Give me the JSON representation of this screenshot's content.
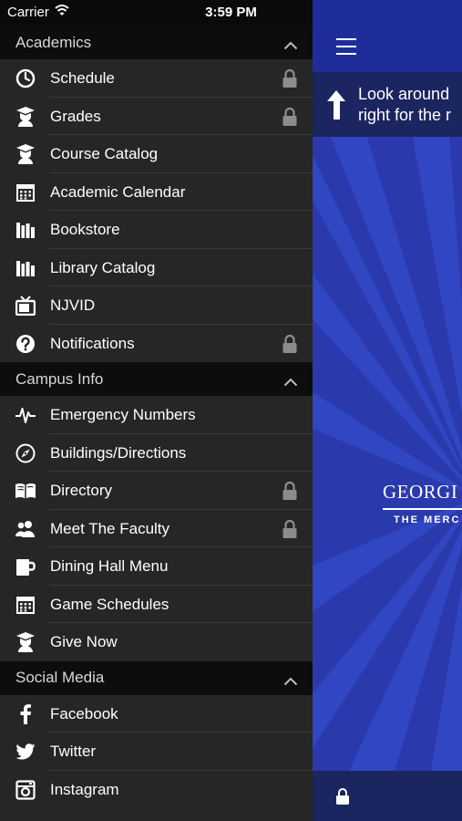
{
  "status_bar": {
    "carrier": "Carrier",
    "time": "3:59 PM"
  },
  "menu": {
    "sections": [
      {
        "title": "Academics",
        "items": [
          {
            "label": "Schedule",
            "icon": "clock-icon",
            "locked": true
          },
          {
            "label": "Grades",
            "icon": "graduate-icon",
            "locked": true
          },
          {
            "label": "Course Catalog",
            "icon": "graduate-icon",
            "locked": false
          },
          {
            "label": "Academic Calendar",
            "icon": "calendar-icon",
            "locked": false
          },
          {
            "label": "Bookstore",
            "icon": "books-icon",
            "locked": false
          },
          {
            "label": "Library Catalog",
            "icon": "books-icon",
            "locked": false
          },
          {
            "label": "NJVID",
            "icon": "tv-icon",
            "locked": false
          },
          {
            "label": "Notifications",
            "icon": "question-icon",
            "locked": true
          }
        ]
      },
      {
        "title": "Campus Info",
        "items": [
          {
            "label": "Emergency Numbers",
            "icon": "pulse-icon",
            "locked": false
          },
          {
            "label": "Buildings/Directions",
            "icon": "compass-icon",
            "locked": false
          },
          {
            "label": "Directory",
            "icon": "book-icon",
            "locked": true
          },
          {
            "label": "Meet The Faculty",
            "icon": "people-icon",
            "locked": true
          },
          {
            "label": "Dining Hall Menu",
            "icon": "mug-icon",
            "locked": false
          },
          {
            "label": "Game Schedules",
            "icon": "calendar-icon",
            "locked": false
          },
          {
            "label": "Give Now",
            "icon": "graduate-icon",
            "locked": false
          }
        ]
      },
      {
        "title": "Social Media",
        "items": [
          {
            "label": "Facebook",
            "icon": "facebook-icon",
            "locked": false
          },
          {
            "label": "Twitter",
            "icon": "twitter-icon",
            "locked": false
          },
          {
            "label": "Instagram",
            "icon": "instagram-icon",
            "locked": false
          }
        ]
      }
    ]
  },
  "app": {
    "banner_line1": "Look around",
    "banner_line2": "right for the r",
    "logo_line1": "GEORGI",
    "logo_line2": "THE MERC"
  },
  "colors": {
    "menu_bg": "#262626",
    "section_bg": "#0d0d0d",
    "app_blue": "#2433a8",
    "banner_bg": "#1b2660"
  }
}
